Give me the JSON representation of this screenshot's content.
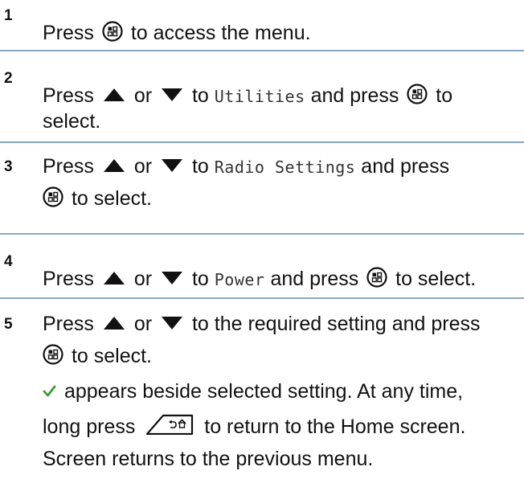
{
  "steps": [
    {
      "number": "1",
      "t_press": "Press",
      "t_end": "to access the menu."
    },
    {
      "number": "2",
      "t_press": "Press",
      "t_or": "or",
      "t_to": "to",
      "item": "Utilities",
      "t_andpress": "and press",
      "t_to2": "to",
      "t_select": "select."
    },
    {
      "number": "3",
      "t_press": "Press",
      "t_or": "or",
      "t_to": "to",
      "item": "Radio Settings",
      "t_andpress": "and press",
      "t_select": "to select."
    },
    {
      "number": "4",
      "t_press": "Press",
      "t_or": "or",
      "t_to": "to",
      "item": "Power",
      "t_andpress": "and press",
      "t_select": "to select."
    },
    {
      "number": "5",
      "t_press": "Press",
      "t_or": "or",
      "t_rest": "to the required setting and press",
      "t_select": "to select.",
      "t_check_text": "appears beside selected setting. At any time,",
      "t_longpress": "long press",
      "t_return": "to return to the Home screen.",
      "t_screen_returns": "Screen returns to the previous menu."
    }
  ],
  "icons": {
    "menu": "menu-ok-button-icon",
    "up": "up-arrow-icon",
    "down": "down-arrow-icon",
    "check": "checkmark-icon",
    "back_home": "back-home-button-icon"
  },
  "colors": {
    "separator": "#8aa6c2",
    "check": "#3a9a3a"
  }
}
